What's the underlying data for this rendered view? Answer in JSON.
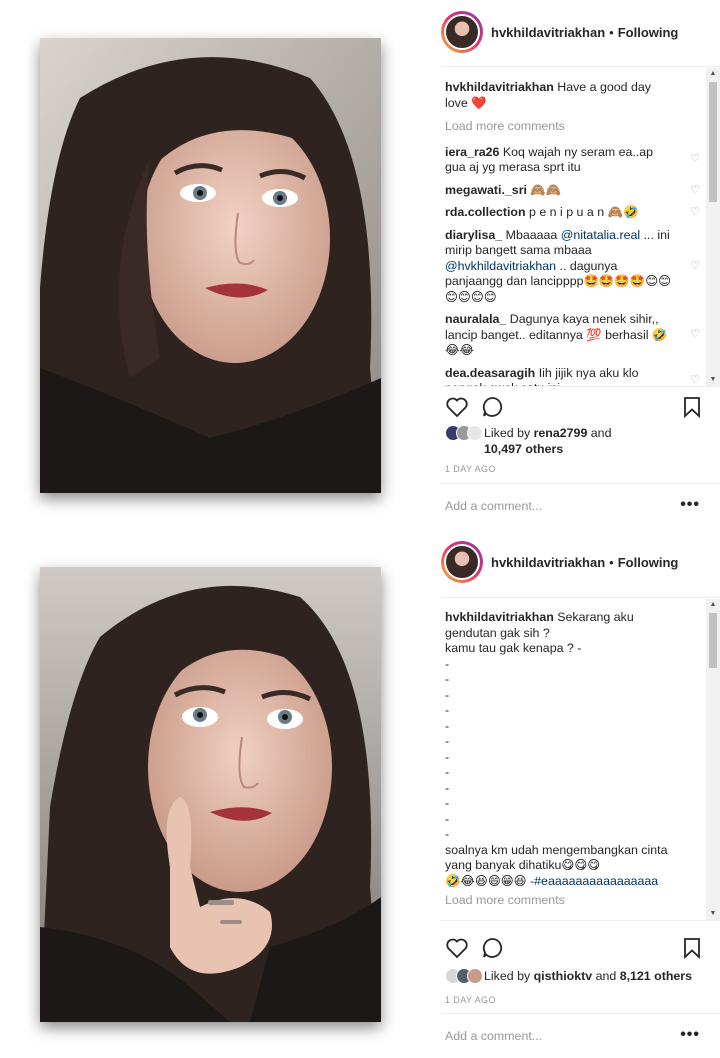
{
  "post1": {
    "username": "hvkhildavitriakhan",
    "follow_status": "Following",
    "caption": {
      "user": "hvkhildavitriakhan",
      "text": "Have a good day love ❤️"
    },
    "load_more": "Load more comments",
    "comments": [
      {
        "user": "iera_ra26",
        "text": "Koq wajah ny seram ea..ap gua aj yg merasa sprt itu"
      },
      {
        "user": "megawati._sri",
        "text": "🙈🙈"
      },
      {
        "user": "rda.collection",
        "text": "p e n i p u a n 🙈🤣"
      },
      {
        "user": "diarylisa_",
        "text_before": "Mbaaaaa ",
        "mention1": "@nitatalia.real",
        "text_mid": " ... ini mirip bangett sama mbaaa ",
        "mention2": "@hvkhildavitriakhan",
        "text_after": " .. dagunya panjaangg dan lancipppp🤩🤩🤩🤩😊😊😊😊😊😊"
      },
      {
        "user": "nauralala_",
        "text": "Dagunya kaya nenek sihir,, lancip banget.. editannya 💯 berhasil 🤣😂😂"
      },
      {
        "user": "dea.deasaragih",
        "text": "Iih jijik nya aku klo nengok cwek satu ini"
      }
    ],
    "liked_by": {
      "prefix": "Liked by ",
      "user": "rena2799",
      "and": " and",
      "others": "10,497 others"
    },
    "time": "1 DAY AGO",
    "add_comment_placeholder": "Add a comment...",
    "more": "•••"
  },
  "post2": {
    "username": "hvkhildavitriakhan",
    "follow_status": "Following",
    "caption": {
      "user": "hvkhildavitriakhan",
      "text": "Sekarang aku gendutan gak sih ?\nkamu tau gak kenapa ? -\n-\n-\n-\n-\n-\n-\n-\n-\n-\n-\n-\n-\nsoalnya km udah mengembangkan cinta yang banyak dihatiku😋😋😋\n🤣😂😆😄😁😆 -",
      "hashtag": "#eaaaaaaaaaaaaaaaa"
    },
    "load_more": "Load more comments",
    "liked_by": {
      "prefix": "Liked by ",
      "user": "qisthioktv",
      "and": " and ",
      "others": "8,121 others"
    },
    "time": "1 DAY AGO",
    "add_comment_placeholder": "Add a comment...",
    "more": "•••"
  },
  "icons": {
    "like": "heart-icon",
    "comment": "comment-icon",
    "save": "bookmark-icon",
    "comment_like": "small-heart-icon"
  },
  "colors": {
    "text": "#262626",
    "muted": "#999999",
    "mention": "#003569",
    "border": "#efefef"
  }
}
